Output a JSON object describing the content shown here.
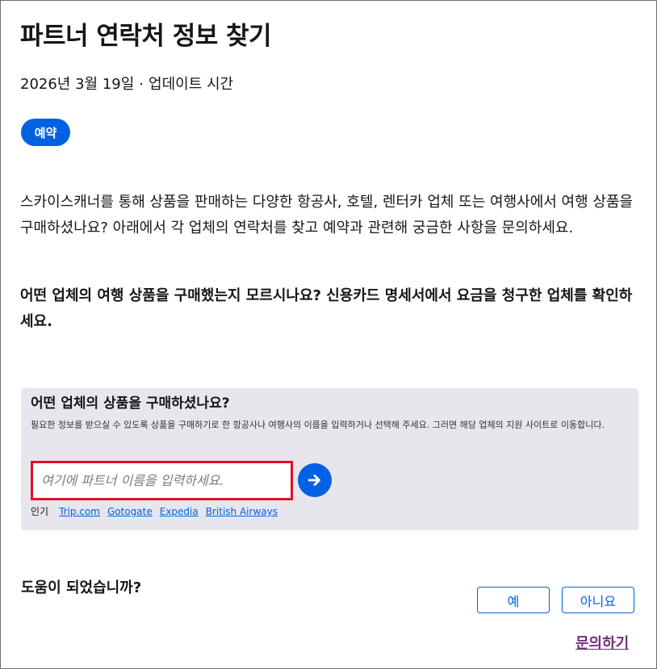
{
  "article": {
    "title": "파트너 연락처 정보 찾기",
    "date": "2026년 3월 19일",
    "separator": "·",
    "updated_label": "업데이트 시간",
    "tag": "예약",
    "paragraph": "스카이스캐너를 통해 상품을 판매하는 다양한 항공사, 호텔, 렌터카 업체 또는 여행사에서 여행 상품을 구매하셨나요? 아래에서 각 업체의 연락처를 찾고 예약과 관련해 궁금한 사항을 문의하세요.",
    "bold_paragraph": "어떤 업체의 여행 상품을 구매했는지 모르시나요? 신용카드 명세서에서 요금을 청구한 업체를 확인하세요."
  },
  "search_panel": {
    "title": "어떤 업체의 상품을 구매하셨나요?",
    "description": "필요한 정보를 받으실 수 있도록 상품을 구매하기로 한 항공사나 여행사의 이름을 입력하거나 선택해 주세요. 그러면 해당 업체의 지원 사이트로 이동합니다.",
    "input_value": "",
    "input_placeholder": "여기에 파트너 이름을 입력하세요.",
    "submit_icon": "arrow-right-icon",
    "popular_label": "인기",
    "popular_links": [
      "Trip.com",
      "Gotogate",
      "Expedia",
      "British Airways"
    ]
  },
  "feedback": {
    "question": "도움이 되었습니까?",
    "yes_label": "예",
    "no_label": "아니요"
  },
  "contact_link": "문의하기",
  "colors": {
    "accent": "#0062e3",
    "highlight_border": "#e0102a",
    "panel_bg": "#e6e6ec",
    "contact_link": "#70307a"
  }
}
